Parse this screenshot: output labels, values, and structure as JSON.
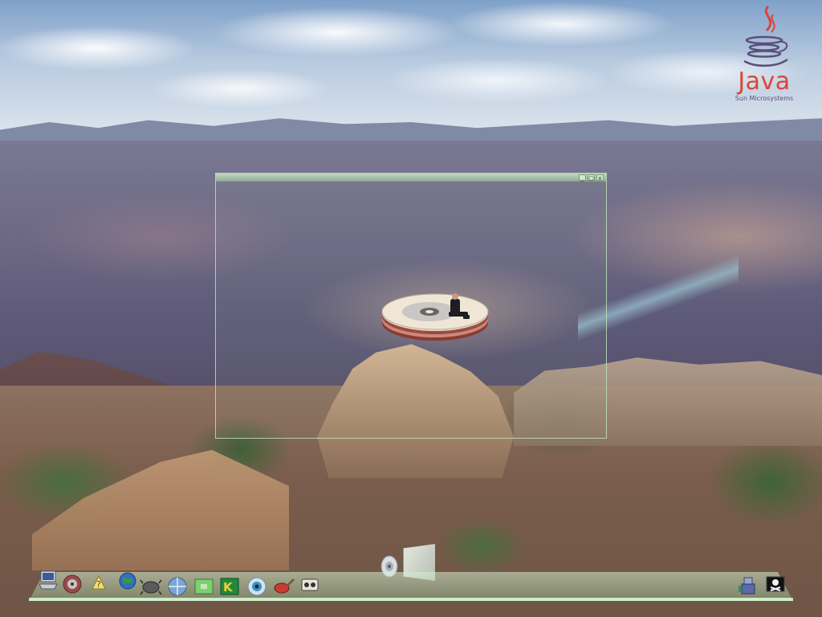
{
  "java_logo": {
    "wordmark": "Java",
    "company": "Sun Microsystems"
  },
  "frame_window": {
    "title": "",
    "controls": [
      "_",
      "□",
      "x"
    ]
  },
  "dock": {
    "icons": [
      "computer-icon",
      "cd-drive-icon",
      "help-icon",
      "network-globe-icon",
      "bug-icon",
      "web-browser-icon",
      "terminal-icon",
      "game-icon",
      "eye-viewer-icon",
      "paint-brush-icon",
      "media-film-icon",
      "user-robot-icon",
      "pirate-flag-icon"
    ]
  },
  "colors": {
    "dock_tint": "#b8dcb3",
    "window_border": "#bee1be",
    "java_red": "#d9463a",
    "java_blue": "#5b4f7a"
  }
}
